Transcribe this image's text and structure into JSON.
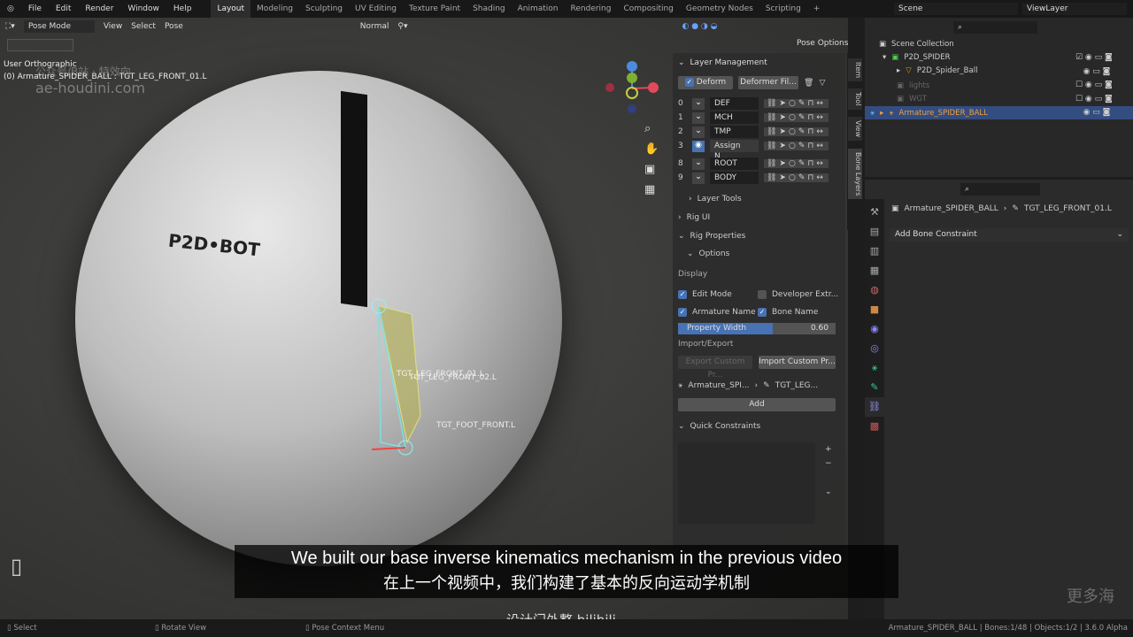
{
  "menu": {
    "items": [
      "File",
      "Edit",
      "Render",
      "Window",
      "Help"
    ]
  },
  "workspaces": [
    "Layout",
    "Modeling",
    "Sculpting",
    "UV Editing",
    "Texture Paint",
    "Shading",
    "Animation",
    "Rendering",
    "Compositing",
    "Geometry Nodes",
    "Scripting",
    "+"
  ],
  "scene": {
    "scene_name": "Scene",
    "view_layer": "ViewLayer"
  },
  "viewport": {
    "mode": "Pose Mode",
    "menus": [
      "View",
      "Select",
      "Pose"
    ],
    "orientation": "Normal",
    "pose_options": "Pose Options",
    "view_name": "User Orthographic",
    "active_info": "(0) Armature_SPIDER_BALL : TGT_LEG_FRONT_01.L",
    "watermark": "ae-houdini.com",
    "watermark_cn": "公众号/B站 · 特效向",
    "logo_text": "P2D•BOT",
    "bone_labels": [
      "TGT_LEG_FRONT_01.L",
      "TGT_LEG_FRONT_02.L",
      "TGT_FOOT_FRONT.L"
    ],
    "gizmo_axes": [
      "X",
      "Y",
      "Z"
    ]
  },
  "npanel": {
    "layer_management": "Layer Management",
    "deform": "Deform",
    "deformer_filter": "Deformer Fil...",
    "layers": [
      {
        "num": "0",
        "name": "DEF"
      },
      {
        "num": "1",
        "name": "MCH"
      },
      {
        "num": "2",
        "name": "TMP"
      },
      {
        "num": "3",
        "name": "Assign N..."
      },
      {
        "num": "8",
        "name": "ROOT"
      },
      {
        "num": "9",
        "name": "BODY"
      }
    ],
    "layer_tools": "Layer Tools",
    "rig_ui": "Rig UI",
    "rig_properties": "Rig Properties",
    "options": "Options",
    "display": "Display",
    "edit_mode": "Edit Mode",
    "developer_extras": "Developer Extr...",
    "armature_name": "Armature Name",
    "bone_name": "Bone Name",
    "property_width_label": "Property Width",
    "property_width": "0.60",
    "property_width_fraction": 0.6,
    "import_export": "Import/Export",
    "export_custom": "Export Custom Pr...",
    "import_custom": "Import Custom Pr...",
    "armature_ref": "Armature_SPI...",
    "bone_ref": "TGT_LEG...",
    "add": "Add",
    "quick_constraints": "Quick Constraints",
    "tabs": [
      "Item",
      "Tool",
      "View",
      "Bone Layers"
    ]
  },
  "outliner": {
    "items": [
      {
        "name": "Scene Collection"
      },
      {
        "name": "P2D_SPIDER"
      },
      {
        "name": "P2D_Spider_Ball"
      },
      {
        "name": "lights"
      },
      {
        "name": "WGT"
      },
      {
        "name": "Armature_SPIDER_BALL"
      }
    ]
  },
  "properties": {
    "armature": "Armature_SPIDER_BALL",
    "bone": "TGT_LEG_FRONT_01.L",
    "add_constraint": "Add Bone Constraint"
  },
  "status": {
    "select": "Select",
    "rotate": "Rotate View",
    "context": "Pose Context Menu",
    "info": "Armature_SPIDER_BALL | Bones:1/48 | Objects:1/2 | 3.6.0 Alpha",
    "channel": "设计门外整 bilibili"
  },
  "subtitles": {
    "en": "We built our base inverse kinematics mechanism in the previous video",
    "zh": "在上一个视频中，我们构建了基本的反向运动学机制"
  },
  "corner_watermark": "更多海"
}
